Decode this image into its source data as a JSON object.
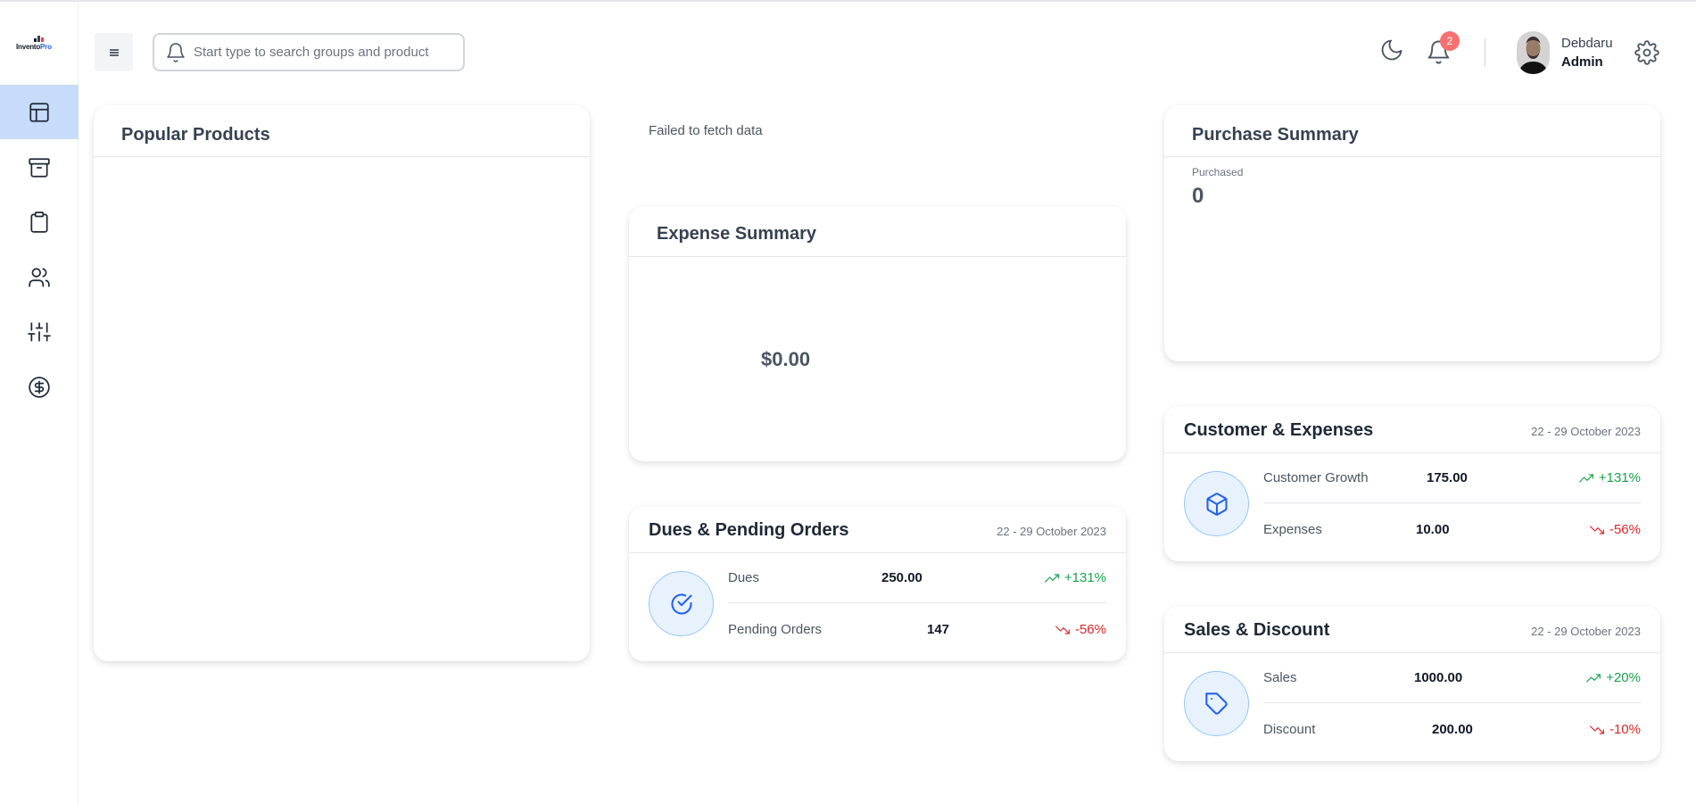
{
  "app": {
    "logo_text_main": "Invento",
    "logo_text_accent": "Pro"
  },
  "sidebar": {
    "items": [
      {
        "name": "dashboard",
        "icon": "layout-icon",
        "active": true
      },
      {
        "name": "inventory",
        "icon": "archive-icon",
        "active": false
      },
      {
        "name": "products",
        "icon": "clipboard-icon",
        "active": false
      },
      {
        "name": "users",
        "icon": "users-icon",
        "active": false
      },
      {
        "name": "settings",
        "icon": "sliders-icon",
        "active": false
      },
      {
        "name": "expenses",
        "icon": "dollar-circle-icon",
        "active": false
      }
    ]
  },
  "header": {
    "search_placeholder": "Start type to search groups and product",
    "notification_count": "2",
    "user_name": "Debdaru",
    "user_role": "Admin"
  },
  "popular_products": {
    "title": "Popular Products"
  },
  "sales_summary": {
    "error": "Failed to fetch data"
  },
  "expense_summary": {
    "title": "Expense Summary",
    "total": "$0.00"
  },
  "purchase_summary": {
    "title": "Purchase Summary",
    "label": "Purchased",
    "value": "0"
  },
  "dues_pending": {
    "title": "Dues & Pending Orders",
    "date_range": "22 - 29 October 2023",
    "rows": [
      {
        "label": "Dues",
        "value": "250.00",
        "change": "+131%",
        "trend": "up"
      },
      {
        "label": "Pending Orders",
        "value": "147",
        "change": "-56%",
        "trend": "down"
      }
    ]
  },
  "customer_expenses": {
    "title": "Customer & Expenses",
    "date_range": "22 - 29 October 2023",
    "rows": [
      {
        "label": "Customer Growth",
        "value": "175.00",
        "change": "+131%",
        "trend": "up"
      },
      {
        "label": "Expenses",
        "value": "10.00",
        "change": "-56%",
        "trend": "down"
      }
    ]
  },
  "sales_discount": {
    "title": "Sales & Discount",
    "date_range": "22 - 29 October 2023",
    "rows": [
      {
        "label": "Sales",
        "value": "1000.00",
        "change": "+20%",
        "trend": "up"
      },
      {
        "label": "Discount",
        "value": "200.00",
        "change": "-10%",
        "trend": "down"
      }
    ]
  },
  "colors": {
    "accent": "#2563eb",
    "active_nav_bg": "#c7dcfb",
    "up": "#16a34a",
    "down": "#dc2626",
    "badge": "#f87171"
  }
}
